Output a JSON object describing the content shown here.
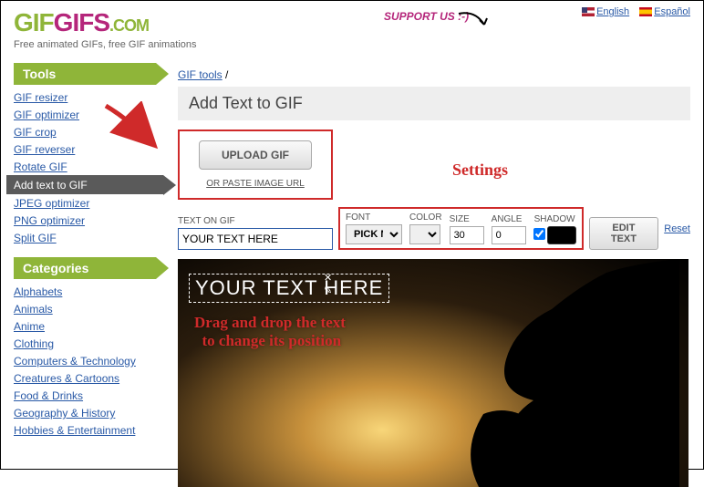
{
  "header": {
    "logo_part1": "GIF",
    "logo_part2": "GIFS",
    "logo_domain": ".COM",
    "tagline": "Free animated GIFs, free GIF animations",
    "support": "SUPPORT US :-)",
    "lang_en": "English",
    "lang_es": "Español"
  },
  "sidebar": {
    "tools_head": "Tools",
    "tools": [
      "GIF resizer",
      "GIF optimizer",
      "GIF crop",
      "GIF reverser",
      "Rotate GIF",
      "Add text to GIF",
      "JPEG optimizer",
      "PNG optimizer",
      "Split GIF"
    ],
    "active_index": 5,
    "cats_head": "Categories",
    "cats": [
      "Alphabets",
      "Animals",
      "Anime",
      "Clothing",
      "Computers & Technology",
      "Creatures & Cartoons",
      "Food & Drinks",
      "Geography & History",
      "Hobbies & Entertainment"
    ]
  },
  "main": {
    "breadcrumb_link": "GIF tools",
    "breadcrumb_sep": "/",
    "title": "Add Text to GIF",
    "upload_btn": "UPLOAD GIF",
    "paste_prefix": "OR ",
    "paste_link": "PASTE IMAGE URL",
    "text_label": "TEXT ON GIF",
    "text_value": "YOUR TEXT HERE",
    "settings_annot": "Settings",
    "font_label": "FONT",
    "font_value": "PICK ME",
    "color_label": "COLOR",
    "size_label": "SIZE",
    "size_value": "30",
    "angle_label": "ANGLE",
    "angle_value": "0",
    "shadow_label": "SHADOW",
    "shadow_checked": true,
    "shadow_color": "#000000",
    "edit_btn": "EDIT TEXT",
    "reset": "Reset",
    "overlay_text": "YOUR TEXT HERE",
    "drag_line1": "Drag and drop the text",
    "drag_line2": "to change its position"
  }
}
